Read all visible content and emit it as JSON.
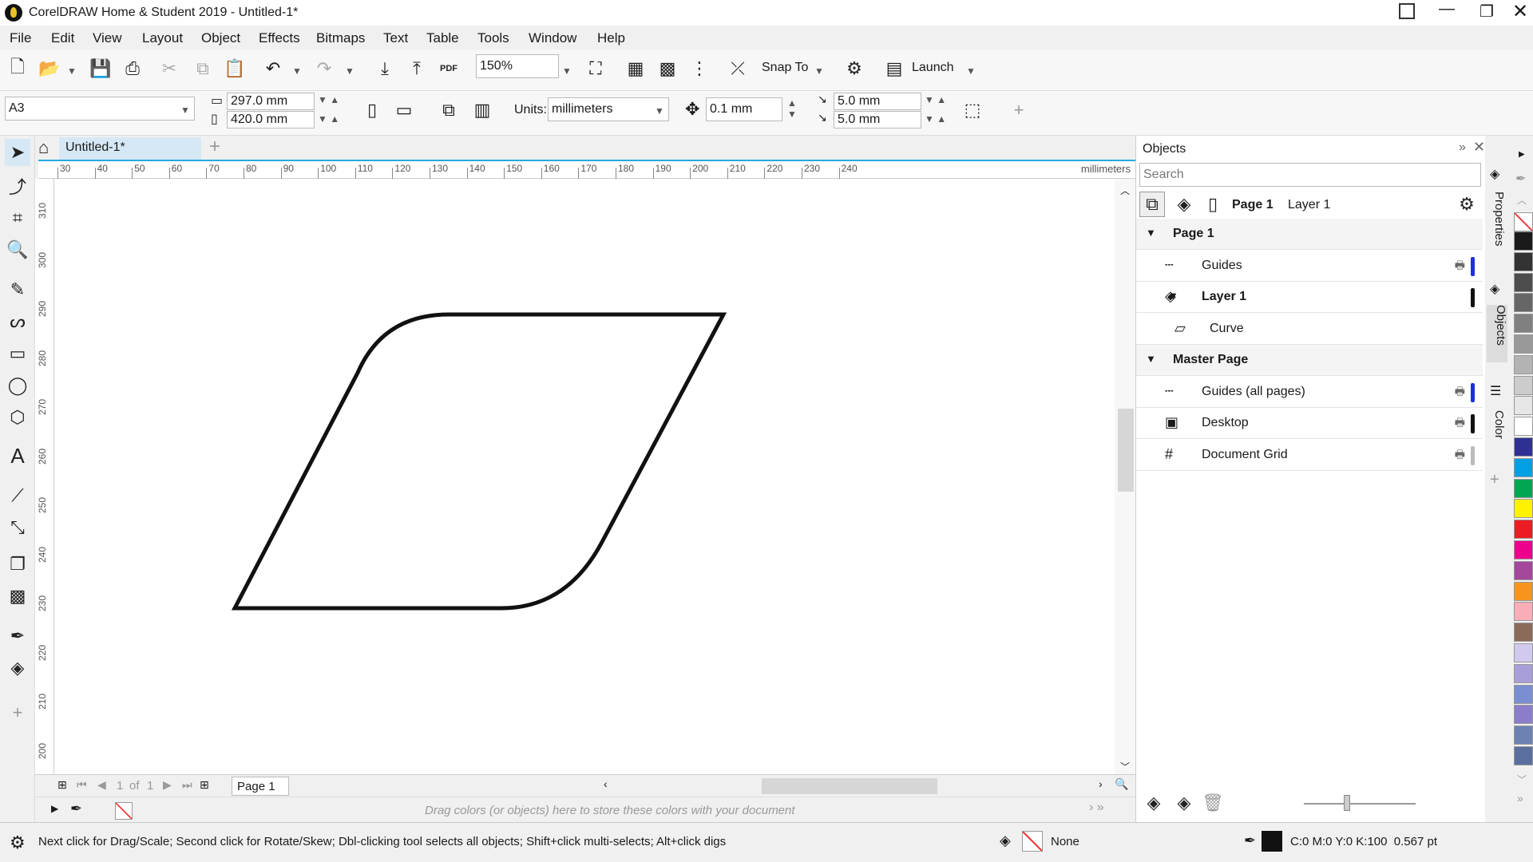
{
  "titlebar": {
    "title": "CorelDRAW Home & Student 2019 - Untitled-1*"
  },
  "menu": [
    "File",
    "Edit",
    "View",
    "Layout",
    "Object",
    "Effects",
    "Bitmaps",
    "Text",
    "Table",
    "Tools",
    "Window",
    "Help"
  ],
  "standard_toolbar": {
    "zoom": "150%",
    "snap_to": "Snap To",
    "launch": "Launch",
    "pdf": "PDF"
  },
  "property_bar": {
    "page_size": "A3",
    "width": "297.0 mm",
    "height": "420.0 mm",
    "units_label": "Units:",
    "units": "millimeters",
    "nudge": "0.1 mm",
    "dup_x": "5.0 mm",
    "dup_y": "5.0 mm"
  },
  "document_tab": "Untitled-1*",
  "hruler": {
    "unit": "millimeters",
    "ticks": [
      "30",
      "40",
      "50",
      "60",
      "70",
      "80",
      "90",
      "100",
      "110",
      "120",
      "130",
      "140",
      "150",
      "160",
      "170",
      "180",
      "190",
      "200",
      "210",
      "220",
      "230",
      "240"
    ]
  },
  "vruler": {
    "ticks": [
      "310",
      "300",
      "290",
      "280",
      "270",
      "260",
      "250",
      "240",
      "230",
      "220",
      "210",
      "200"
    ]
  },
  "page_nav": {
    "current": "1",
    "of": "of",
    "total": "1",
    "page_tab": "Page 1"
  },
  "colorbar_hint": "Drag colors (or objects) here to store these colors with your document",
  "docker": {
    "title": "Objects",
    "search_placeholder": "Search",
    "current_page": "Page 1",
    "current_layer": "Layer 1",
    "tree": [
      {
        "label": "Page 1",
        "bold": true,
        "level": 0,
        "expanded": true,
        "icon": "",
        "bar": ""
      },
      {
        "label": "Guides",
        "bold": false,
        "level": 1,
        "icon": "guides-icon",
        "bar": "#1f2ee0"
      },
      {
        "label": "Layer 1",
        "bold": true,
        "level": 1,
        "expanded": true,
        "icon": "layer-icon",
        "bar": "#111111"
      },
      {
        "label": "Curve",
        "bold": false,
        "level": 2,
        "icon": "curve-icon",
        "bar": ""
      },
      {
        "label": "Master Page",
        "bold": true,
        "level": 0,
        "expanded": true,
        "icon": "",
        "bar": ""
      },
      {
        "label": "Guides (all pages)",
        "bold": false,
        "level": 1,
        "icon": "guides-icon",
        "bar": "#1f2ee0"
      },
      {
        "label": "Desktop",
        "bold": false,
        "level": 1,
        "icon": "desktop-icon",
        "bar": "#111111"
      },
      {
        "label": "Document Grid",
        "bold": false,
        "level": 1,
        "icon": "grid-icon",
        "bar": "#bbbbbb"
      }
    ]
  },
  "docker_tabs": [
    "Properties",
    "Objects",
    "Color"
  ],
  "palette": [
    "#1a1a1a",
    "#333333",
    "#4d4d4d",
    "#666666",
    "#808080",
    "#999999",
    "#b3b3b3",
    "#cccccc",
    "#e6e6e6",
    "#ffffff",
    "#2e3192",
    "#00a0e3",
    "#00a651",
    "#fff200",
    "#ed1c24",
    "#ec008c",
    "#a3489a",
    "#f7941d",
    "#f9aeb7",
    "#8b6a5a",
    "#d2c9ef",
    "#a89fd8",
    "#7a8fd1",
    "#8b7dc9",
    "#6d82b3",
    "#5a6f9e"
  ],
  "status": {
    "hint": "Next click for Drag/Scale; Second click for Rotate/Skew; Dbl-clicking tool selects all objects; Shift+click multi-selects; Alt+click digs",
    "fill": "None",
    "outline": "C:0 M:0 Y:0 K:100  0.567 pt"
  }
}
